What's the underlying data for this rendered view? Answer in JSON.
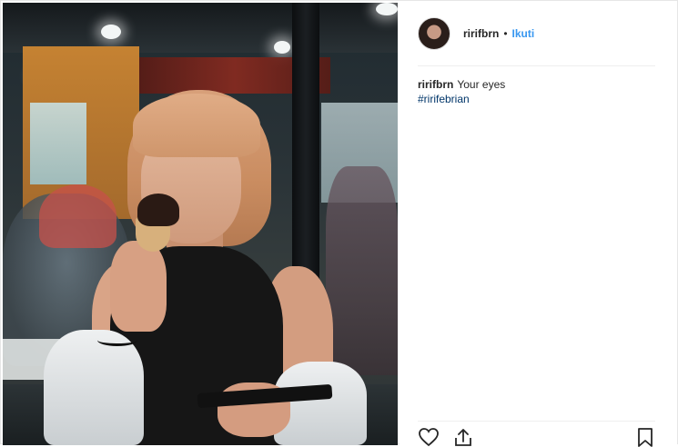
{
  "post": {
    "author": {
      "username": "ririfbrn",
      "separator": "•",
      "follow_label": "Ikuti"
    },
    "caption": {
      "username": "ririfbrn",
      "text": "Your eyes",
      "hashtag": "#ririfebrian"
    },
    "actions": {
      "icons": [
        "heart-icon",
        "share-icon",
        "bookmark-icon"
      ]
    }
  },
  "colors": {
    "link": "#3897f0",
    "hashtag": "#003569",
    "text": "#262626",
    "divider": "#efefef"
  }
}
